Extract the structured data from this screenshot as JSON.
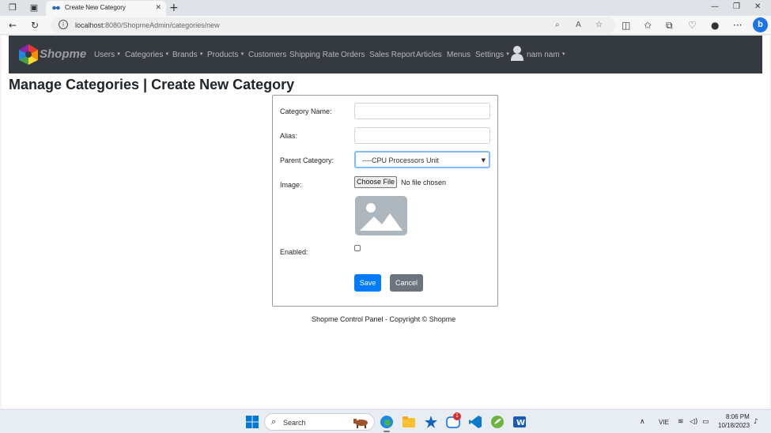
{
  "browser": {
    "tab_title": "Create New Category",
    "url_host": "localhost",
    "url_rest": ":8080/ShopmeAdmin/categories/new"
  },
  "navbar": {
    "brand": "Shopme",
    "items": [
      {
        "label": "Users",
        "dropdown": true
      },
      {
        "label": "Categories",
        "dropdown": true
      },
      {
        "label": "Brands",
        "dropdown": true
      },
      {
        "label": "Products",
        "dropdown": true
      },
      {
        "label": "Customers",
        "dropdown": false
      },
      {
        "label": "Shipping Rate",
        "dropdown": false
      },
      {
        "label": "Orders",
        "dropdown": false
      },
      {
        "label": "Sales Report",
        "dropdown": false
      },
      {
        "label": "Articles",
        "dropdown": false
      },
      {
        "label": "Menus",
        "dropdown": false
      },
      {
        "label": "Settings",
        "dropdown": true
      }
    ],
    "user_name": "nam nam"
  },
  "page": {
    "title": "Manage Categories | Create New Category"
  },
  "form": {
    "category_name_label": "Category Name:",
    "category_name_value": "",
    "alias_label": "Alias:",
    "alias_value": "",
    "parent_label": "Parent Category:",
    "parent_selected": "----CPU Processors Unit",
    "image_label": "Image:",
    "choose_file_label": "Choose File",
    "file_status": "No file chosen",
    "enabled_label": "Enabled:",
    "enabled_checked": false,
    "save_label": "Save",
    "cancel_label": "Cancel"
  },
  "footer": {
    "text": "Shopme Control Panel - Copyright © Shopme"
  },
  "taskbar": {
    "search_label": "Search",
    "notification_count": "1",
    "language": "VIE",
    "time": "8:06 PM",
    "date": "10/18/2023"
  },
  "colors": {
    "navbar_bg": "#343a40",
    "primary": "#007bff",
    "secondary": "#6c757d"
  }
}
